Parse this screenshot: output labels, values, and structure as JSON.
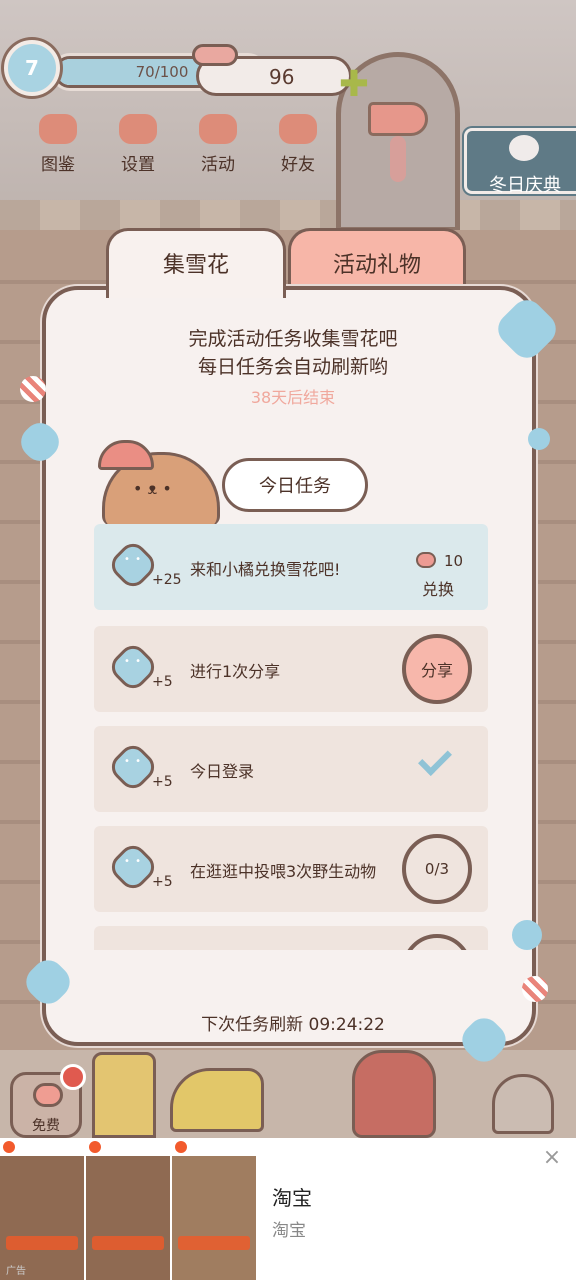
{
  "hud": {
    "level": "7",
    "xp_text": "70/100",
    "xp_progress": 0.7,
    "hearts": "96"
  },
  "top_menu": [
    {
      "label": "图鉴",
      "icon": "cat-book-icon"
    },
    {
      "label": "设置",
      "icon": "gear-icon"
    },
    {
      "label": "活动",
      "icon": "gift-icon"
    },
    {
      "label": "好友",
      "icon": "friends-icon"
    }
  ],
  "event_banner": {
    "label": "冬日庆典",
    "icon": "snowflake-icon"
  },
  "tabs": {
    "active": "集雪花",
    "inactive": "活动礼物"
  },
  "panel": {
    "headline_1": "完成活动任务收集雪花吧",
    "headline_2": "每日任务会自动刷新哟",
    "countdown": "38天后结束",
    "today_label": "今日任务",
    "refresh_text": "下次任务刷新 09:24:22"
  },
  "tasks": [
    {
      "reward": "+25",
      "label": "来和小橘兑换雪花吧!",
      "cost": "10",
      "action": "兑换",
      "state": "exchange"
    },
    {
      "reward": "+5",
      "label": "进行1次分享",
      "action": "分享",
      "state": "share"
    },
    {
      "reward": "+5",
      "label": "今日登录",
      "state": "done"
    },
    {
      "reward": "+5",
      "label": "在逛逛中投喂3次野生动物",
      "progress": "0/3",
      "state": "progress"
    }
  ],
  "free_button": {
    "label": "免费"
  },
  "ad": {
    "title": "淘宝",
    "subtitle": "淘宝",
    "close": "×",
    "tag": "广告"
  },
  "colors": {
    "panel_bg": "#f7f1ef",
    "accent_pink": "#f7b6a8",
    "accent_blue": "#a9d3e2",
    "outline": "#7a5e54"
  }
}
